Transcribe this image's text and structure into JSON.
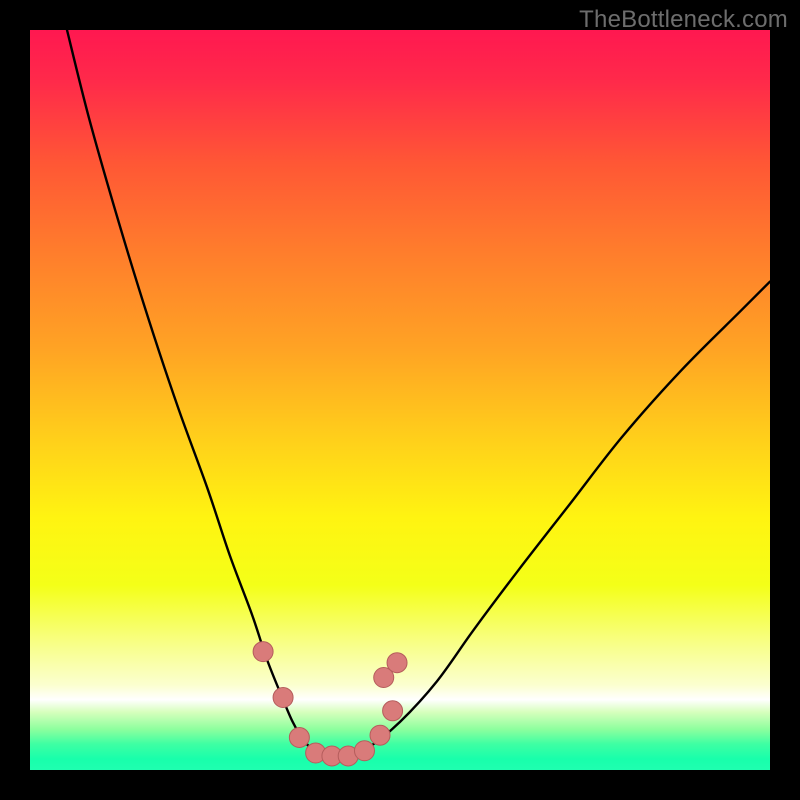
{
  "watermark": "TheBottleneck.com",
  "colors": {
    "frame": "#000000",
    "curve_stroke": "#000000",
    "marker_fill": "#d97b7a",
    "marker_stroke": "#b55d5c",
    "gradient_stops": [
      {
        "offset": 0.0,
        "color": "#ff1850"
      },
      {
        "offset": 0.07,
        "color": "#ff2a4a"
      },
      {
        "offset": 0.18,
        "color": "#ff5735"
      },
      {
        "offset": 0.3,
        "color": "#ff7d2c"
      },
      {
        "offset": 0.43,
        "color": "#ffa324"
      },
      {
        "offset": 0.56,
        "color": "#ffd21a"
      },
      {
        "offset": 0.66,
        "color": "#fff411"
      },
      {
        "offset": 0.75,
        "color": "#f4ff18"
      },
      {
        "offset": 0.83,
        "color": "#f8ff88"
      },
      {
        "offset": 0.885,
        "color": "#fbffcf"
      },
      {
        "offset": 0.905,
        "color": "#ffffff"
      },
      {
        "offset": 0.922,
        "color": "#d6ffbc"
      },
      {
        "offset": 0.945,
        "color": "#8dff9e"
      },
      {
        "offset": 0.965,
        "color": "#3effa3"
      },
      {
        "offset": 0.985,
        "color": "#18ffab"
      },
      {
        "offset": 1.0,
        "color": "#1fffb0"
      }
    ]
  },
  "chart_data": {
    "type": "line",
    "title": "",
    "xlabel": "",
    "ylabel": "",
    "xlim": [
      0,
      100
    ],
    "ylim": [
      0,
      100
    ],
    "note": "Axes are unlabeled; x/y expressed as 0–100 percent of plot area. y=0 is the green bottom (best), y=100 is the red top (worst).",
    "series": [
      {
        "name": "bottleneck-curve",
        "x": [
          5,
          8,
          12,
          16,
          20,
          24,
          27,
          30,
          32,
          34,
          35.5,
          37,
          38.5,
          40,
          42,
          44,
          46,
          50,
          55,
          60,
          66,
          73,
          80,
          88,
          96,
          100
        ],
        "y": [
          100,
          88,
          74,
          61,
          49,
          38,
          29,
          21,
          15,
          10,
          6.5,
          4,
          2.5,
          2,
          2,
          2.3,
          3.2,
          6.5,
          12,
          19,
          27,
          36,
          45,
          54,
          62,
          66
        ]
      }
    ],
    "markers": {
      "name": "highlighted-points",
      "x": [
        31.5,
        34.2,
        36.4,
        38.6,
        40.8,
        43.0,
        45.2,
        47.3,
        49.0,
        47.8,
        49.6
      ],
      "y": [
        16.0,
        9.8,
        4.4,
        2.3,
        1.9,
        1.9,
        2.6,
        4.7,
        8.0,
        12.5,
        14.5
      ]
    }
  }
}
